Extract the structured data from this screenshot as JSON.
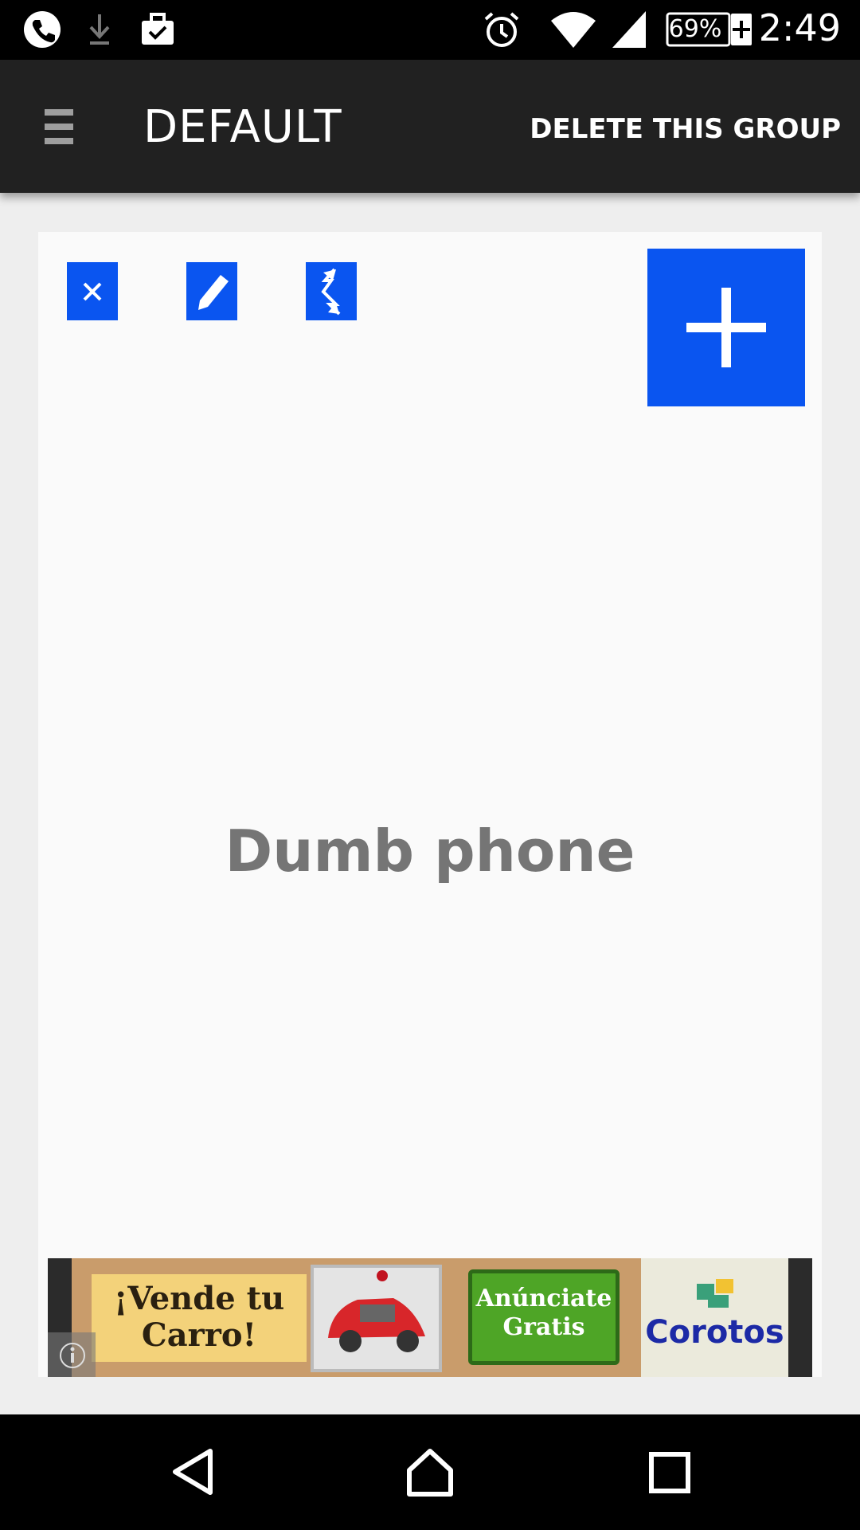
{
  "status_bar": {
    "time": "2:49",
    "battery_percent": "69%",
    "icons": [
      "phone-icon",
      "download-icon",
      "briefcase-check-icon",
      "alarm-icon",
      "wifi-icon",
      "signal-icon",
      "battery-icon"
    ]
  },
  "toolbar": {
    "menu_icon": "hamburger-menu-icon",
    "title": "DEFAULT",
    "action_label": "DELETE THIS GROUP"
  },
  "card": {
    "buttons": [
      "close-icon",
      "pencil-icon",
      "swap-icon"
    ],
    "add_icon": "plus-icon",
    "group_name": "Dumb phone",
    "accent_color": "#0a55f0"
  },
  "ad": {
    "headline": "¡Vende tu Carro!",
    "cta": "Anúnciate Gratis",
    "brand": "Corotos",
    "info_icon": "info-icon"
  },
  "nav_bar": {
    "buttons": [
      "back-icon",
      "home-icon",
      "recents-icon"
    ]
  }
}
